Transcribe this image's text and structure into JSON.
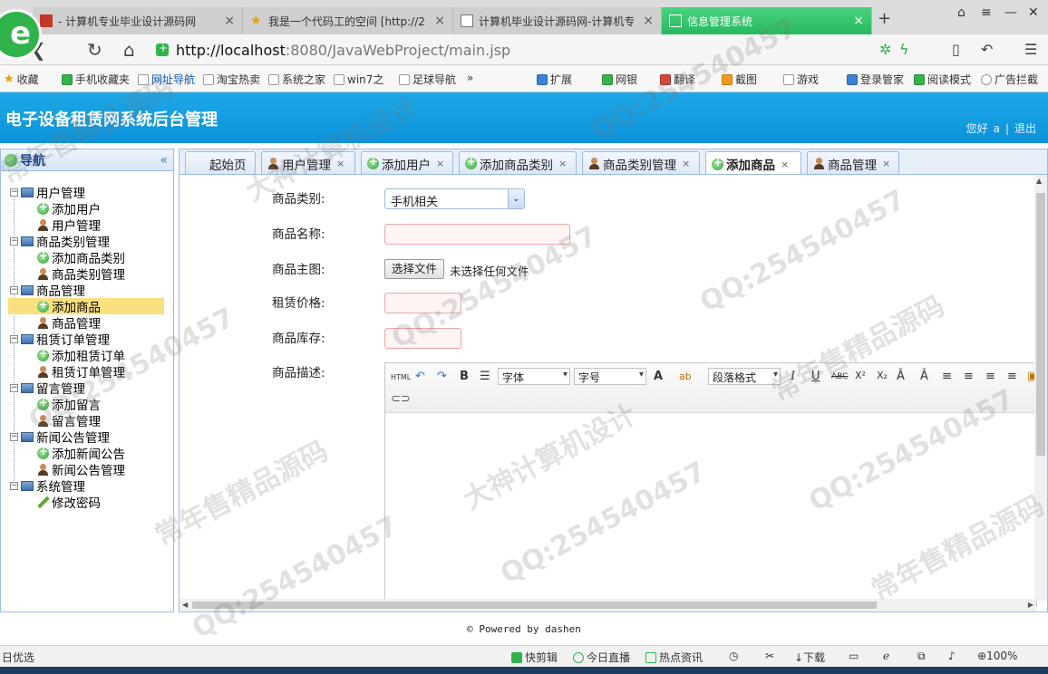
{
  "browser": {
    "tabs": [
      {
        "title": "- 计算机专业毕业设计源码网",
        "close": "×"
      },
      {
        "title": "我是一个代码工的空间 [http://2",
        "close": "×"
      },
      {
        "title": "计算机毕业设计源码网-计算机专",
        "close": "×"
      },
      {
        "title": "信息管理系统",
        "close": "×"
      }
    ],
    "new_tab": "+",
    "url_host": "http://localhost",
    "url_rest": ":8080/JavaWebProject/main.jsp"
  },
  "bookmarks": {
    "items": [
      "收藏",
      "手机收藏夹",
      "网址导航",
      "淘宝热卖",
      "系统之家",
      "win7之",
      "足球导航"
    ],
    "more": "»",
    "right_items": [
      "扩展",
      "网银",
      "翻译",
      "截图",
      "游戏",
      "登录管家",
      "阅读模式",
      "广告拦截"
    ]
  },
  "app": {
    "title": "电子设备租赁网系统后台管理",
    "greeting": "您好",
    "user": "a",
    "separator": "|",
    "logout": "退出"
  },
  "nav": {
    "title": "导航",
    "collapse": "«",
    "groups": [
      {
        "label": "用户管理",
        "items": [
          "添加用户",
          "用户管理"
        ]
      },
      {
        "label": "商品类别管理",
        "items": [
          "添加商品类别",
          "商品类别管理"
        ]
      },
      {
        "label": "商品管理",
        "items": [
          "添加商品",
          "商品管理"
        ]
      },
      {
        "label": "租赁订单管理",
        "items": [
          "添加租赁订单",
          "租赁订单管理"
        ]
      },
      {
        "label": "留言管理",
        "items": [
          "添加留言",
          "留言管理"
        ]
      },
      {
        "label": "新闻公告管理",
        "items": [
          "添加新闻公告",
          "新闻公告管理"
        ]
      },
      {
        "label": "系统管理",
        "items": [
          "修改密码"
        ]
      }
    ],
    "selected": "添加商品"
  },
  "content_tabs": [
    {
      "label": "起始页"
    },
    {
      "label": "用户管理",
      "close": "×"
    },
    {
      "label": "添加用户",
      "close": "×"
    },
    {
      "label": "添加商品类别",
      "close": "×"
    },
    {
      "label": "商品类别管理",
      "close": "×"
    },
    {
      "label": "添加商品",
      "close": "×"
    },
    {
      "label": "商品管理",
      "close": "×"
    }
  ],
  "form": {
    "category_label": "商品类别:",
    "category_value": "手机相关",
    "name_label": "商品名称:",
    "image_label": "商品主图:",
    "file_button": "选择文件",
    "file_status": "未选择任何文件",
    "price_label": "租赁价格:",
    "stock_label": "商品库存:",
    "desc_label": "商品描述:"
  },
  "editor": {
    "html_btn": "HTML",
    "bold": "B",
    "font_family": "字体",
    "font_size": "字号",
    "font_color": "A",
    "highlight": "ab",
    "paragraph": "段落格式",
    "italic": "I",
    "underline": "U",
    "strike": "ABC",
    "superscript": "X²",
    "subscript": "X₂"
  },
  "footer": "© Powered by dashen",
  "statusbar": {
    "left": "日优选",
    "items": [
      "快剪辑",
      "今日直播",
      "热点资讯",
      "下载"
    ],
    "zoom": "100%"
  },
  "watermarks": [
    "QQ:254540457",
    "常年售精品源码",
    "大神计算机设计"
  ]
}
